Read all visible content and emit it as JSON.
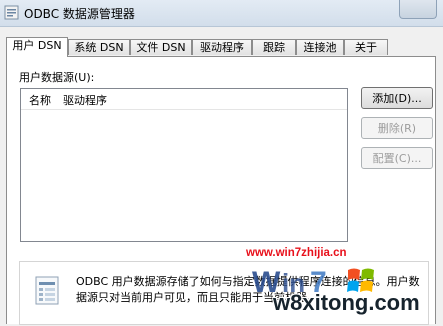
{
  "window": {
    "title": "ODBC 数据源管理器"
  },
  "tabs": [
    {
      "label": "用户 DSN",
      "active": true
    },
    {
      "label": "系统 DSN",
      "active": false
    },
    {
      "label": "文件 DSN",
      "active": false
    },
    {
      "label": "驱动程序",
      "active": false
    },
    {
      "label": "跟踪",
      "active": false
    },
    {
      "label": "连接池",
      "active": false
    },
    {
      "label": "关于",
      "active": false
    }
  ],
  "user_dsn": {
    "list_label": "用户数据源(U):",
    "columns": [
      "名称",
      "驱动程序"
    ],
    "rows": []
  },
  "buttons": {
    "add": "添加(D)...",
    "remove": "删除(R)",
    "configure": "配置(C)..."
  },
  "info": {
    "text": "ODBC 用户数据源存储了如何与指定数据提供程序连接的信息。用户数据源只对当前用户可见，而且只能用于当前机器。"
  },
  "watermark": {
    "url": "www.win7zhijia.cn",
    "site": "w8xitong.com"
  }
}
